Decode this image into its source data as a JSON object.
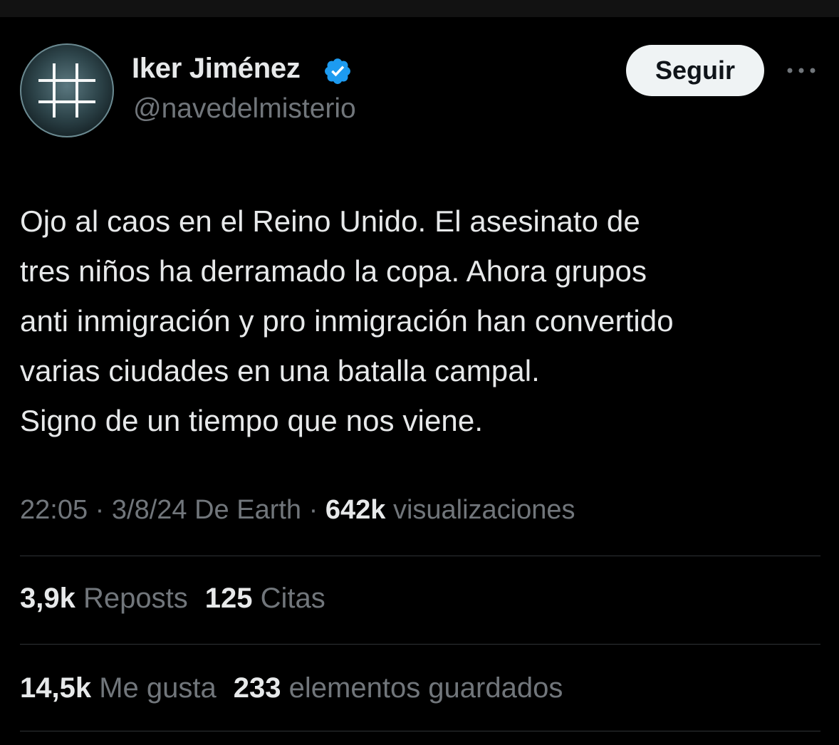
{
  "author": {
    "display_name": "Iker Jiménez",
    "handle": "@navedelmisterio",
    "verified": true,
    "avatar_icon": "hash-grid-icon"
  },
  "actions": {
    "follow_label": "Seguir",
    "more_icon": "more-dots-icon"
  },
  "tweet": {
    "text": "Ojo al caos en el Reino Unido. El asesinato de\ntres niños ha derramado la copa. Ahora grupos\nanti inmigración y pro inmigración han convertido\nvarias ciudades en una batalla campal.\nSigno de un tiempo que nos viene.",
    "time": "22:05",
    "date": "3/8/24",
    "source": "De Earth",
    "separator": "·",
    "views_count": "642k",
    "views_label": "visualizaciones"
  },
  "stats": {
    "reposts_count": "3,9k",
    "reposts_label": "Reposts",
    "quotes_count": "125",
    "quotes_label": "Citas",
    "likes_count": "14,5k",
    "likes_label": "Me gusta",
    "bookmarks_count": "233",
    "bookmarks_label": "elementos guardados"
  },
  "colors": {
    "background": "#000000",
    "text_primary": "#e7e9ea",
    "text_secondary": "#71767b",
    "verified_blue": "#1d9bf0",
    "follow_button_bg": "#eff3f4",
    "divider": "#2f3336"
  }
}
